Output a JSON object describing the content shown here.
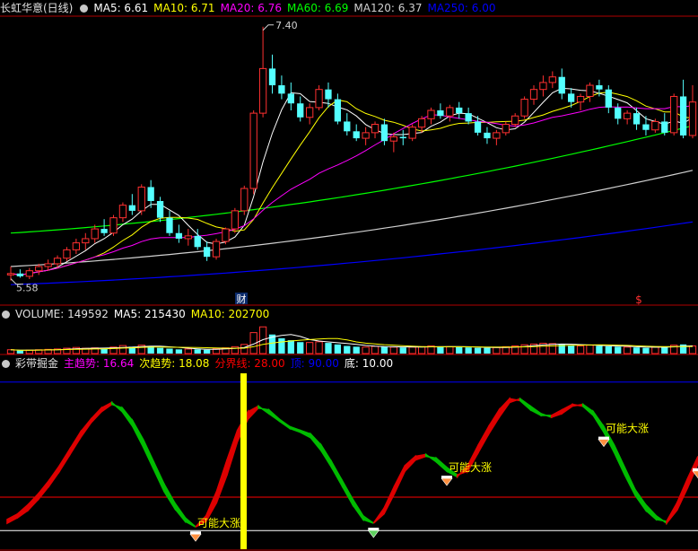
{
  "header_main": {
    "title": "长虹华意(日线)",
    "items": [
      {
        "label": "MA5: 6.61",
        "color": "#ffffff"
      },
      {
        "label": "MA10: 6.71",
        "color": "#ffff00"
      },
      {
        "label": "MA20: 6.76",
        "color": "#ff00ff"
      },
      {
        "label": "MA60: 6.69",
        "color": "#00ff00"
      },
      {
        "label": "MA120: 6.37",
        "color": "#d0d0d0"
      },
      {
        "label": "MA250: 6.00",
        "color": "#0000ff"
      }
    ]
  },
  "header_volume": {
    "title": "VOLUME: 149592",
    "items": [
      {
        "label": "MA5: 215430",
        "color": "#ffffff"
      },
      {
        "label": "MA10: 202700",
        "color": "#ffff00"
      }
    ]
  },
  "header_indicator": {
    "title": "彩带掘金",
    "items": [
      {
        "label": "主趋势: 16.64",
        "color": "#ff00ff"
      },
      {
        "label": "次趋势: 18.08",
        "color": "#ffff00"
      },
      {
        "label": "分界线: 28.00",
        "color": "#ff0000"
      },
      {
        "label": "顶: 90.00",
        "color": "#0000ff"
      },
      {
        "label": "底: 10.00",
        "color": "#ffffff"
      }
    ]
  },
  "annotations": {
    "high_label": "7.40",
    "low_label": "5.58",
    "event_cai": "财",
    "event_s": "$",
    "signal_text": "可能大涨"
  },
  "colors": {
    "up": "#ff3030",
    "down": "#54ffff",
    "ribbon_up": "#dd0000",
    "ribbon_down": "#00bb00",
    "cursor": "#ffff00",
    "panel_border": "#b00000"
  },
  "chart_data": [
    {
      "type": "candlestick",
      "panel": "price",
      "x_unit": "trading day index",
      "ylim": [
        5.5,
        7.45
      ],
      "candles": [
        [
          5.62,
          5.68,
          5.58,
          5.63
        ],
        [
          5.63,
          5.66,
          5.6,
          5.61
        ],
        [
          5.61,
          5.67,
          5.59,
          5.65
        ],
        [
          5.65,
          5.7,
          5.62,
          5.68
        ],
        [
          5.68,
          5.73,
          5.65,
          5.7
        ],
        [
          5.7,
          5.76,
          5.67,
          5.74
        ],
        [
          5.74,
          5.82,
          5.72,
          5.8
        ],
        [
          5.8,
          5.88,
          5.77,
          5.85
        ],
        [
          5.85,
          5.92,
          5.8,
          5.88
        ],
        [
          5.88,
          5.98,
          5.85,
          5.95
        ],
        [
          5.95,
          6.02,
          5.9,
          5.92
        ],
        [
          5.92,
          6.05,
          5.9,
          6.03
        ],
        [
          6.03,
          6.14,
          6.0,
          6.12
        ],
        [
          6.12,
          6.2,
          6.05,
          6.08
        ],
        [
          6.08,
          6.27,
          6.05,
          6.25
        ],
        [
          6.25,
          6.3,
          6.1,
          6.15
        ],
        [
          6.15,
          6.18,
          6.0,
          6.03
        ],
        [
          6.03,
          6.08,
          5.9,
          5.92
        ],
        [
          5.92,
          5.98,
          5.85,
          5.88
        ],
        [
          5.88,
          5.95,
          5.83,
          5.9
        ],
        [
          5.9,
          5.95,
          5.8,
          5.82
        ],
        [
          5.82,
          5.86,
          5.72,
          5.75
        ],
        [
          5.75,
          5.88,
          5.73,
          5.86
        ],
        [
          5.86,
          5.96,
          5.84,
          5.95
        ],
        [
          5.95,
          6.1,
          5.92,
          6.08
        ],
        [
          6.08,
          6.26,
          6.05,
          6.24
        ],
        [
          6.24,
          6.8,
          6.2,
          6.78
        ],
        [
          6.78,
          7.4,
          6.75,
          7.1
        ],
        [
          7.1,
          7.2,
          6.92,
          6.98
        ],
        [
          6.98,
          7.05,
          6.88,
          6.92
        ],
        [
          6.92,
          7.0,
          6.8,
          6.85
        ],
        [
          6.85,
          6.9,
          6.72,
          6.75
        ],
        [
          6.75,
          6.85,
          6.7,
          6.82
        ],
        [
          6.82,
          6.98,
          6.8,
          6.95
        ],
        [
          6.95,
          7.0,
          6.82,
          6.88
        ],
        [
          6.88,
          6.92,
          6.7,
          6.72
        ],
        [
          6.72,
          6.78,
          6.62,
          6.65
        ],
        [
          6.65,
          6.7,
          6.58,
          6.6
        ],
        [
          6.6,
          6.68,
          6.55,
          6.64
        ],
        [
          6.64,
          6.72,
          6.6,
          6.7
        ],
        [
          6.7,
          6.74,
          6.55,
          6.58
        ],
        [
          6.58,
          6.64,
          6.5,
          6.61
        ],
        [
          6.61,
          6.66,
          6.55,
          6.6
        ],
        [
          6.6,
          6.7,
          6.58,
          6.68
        ],
        [
          6.68,
          6.76,
          6.64,
          6.74
        ],
        [
          6.74,
          6.82,
          6.7,
          6.8
        ],
        [
          6.8,
          6.85,
          6.74,
          6.76
        ],
        [
          6.76,
          6.84,
          6.72,
          6.82
        ],
        [
          6.82,
          6.86,
          6.74,
          6.78
        ],
        [
          6.78,
          6.82,
          6.7,
          6.72
        ],
        [
          6.72,
          6.76,
          6.62,
          6.64
        ],
        [
          6.64,
          6.68,
          6.56,
          6.6
        ],
        [
          6.6,
          6.66,
          6.55,
          6.64
        ],
        [
          6.64,
          6.72,
          6.62,
          6.7
        ],
        [
          6.7,
          6.78,
          6.68,
          6.76
        ],
        [
          6.76,
          6.9,
          6.74,
          6.88
        ],
        [
          6.88,
          6.98,
          6.84,
          6.95
        ],
        [
          6.95,
          7.05,
          6.9,
          7.0
        ],
        [
          7.0,
          7.08,
          6.96,
          7.04
        ],
        [
          7.04,
          7.1,
          6.88,
          6.92
        ],
        [
          6.92,
          6.96,
          6.82,
          6.86
        ],
        [
          6.86,
          6.92,
          6.8,
          6.9
        ],
        [
          6.9,
          7.0,
          6.86,
          6.98
        ],
        [
          6.98,
          7.02,
          6.9,
          6.95
        ],
        [
          6.95,
          6.98,
          6.78,
          6.82
        ],
        [
          6.82,
          6.85,
          6.7,
          6.74
        ],
        [
          6.74,
          6.8,
          6.7,
          6.78
        ],
        [
          6.78,
          6.82,
          6.66,
          6.7
        ],
        [
          6.7,
          6.76,
          6.62,
          6.66
        ],
        [
          6.66,
          6.74,
          6.64,
          6.72
        ],
        [
          6.72,
          6.78,
          6.62,
          6.64
        ],
        [
          6.64,
          6.92,
          6.62,
          6.9
        ],
        [
          6.9,
          7.02,
          6.6,
          6.62
        ],
        [
          6.62,
          6.98,
          6.6,
          6.86
        ]
      ],
      "ma_series": [
        {
          "name": "MA5",
          "color": "#ffffff"
        },
        {
          "name": "MA10",
          "color": "#ffff00"
        },
        {
          "name": "MA20",
          "color": "#ff00ff"
        }
      ],
      "long_ma_series": [
        {
          "name": "MA60",
          "color": "#00ff00",
          "from": 5.92,
          "to": 6.69
        },
        {
          "name": "MA120",
          "color": "#d0d0d0",
          "from": 5.68,
          "to": 6.37
        },
        {
          "name": "MA250",
          "color": "#0000ff",
          "from": 5.55,
          "to": 6.0
        }
      ]
    },
    {
      "type": "bar",
      "panel": "volume",
      "values": [
        20,
        16,
        18,
        20,
        22,
        24,
        28,
        32,
        28,
        30,
        26,
        34,
        42,
        36,
        44,
        40,
        30,
        26,
        22,
        24,
        22,
        20,
        26,
        30,
        36,
        48,
        110,
        140,
        100,
        80,
        70,
        60,
        58,
        62,
        56,
        48,
        40,
        36,
        34,
        38,
        36,
        34,
        32,
        34,
        36,
        40,
        38,
        36,
        34,
        32,
        30,
        30,
        32,
        36,
        40,
        46,
        50,
        54,
        52,
        48,
        42,
        40,
        44,
        40,
        38,
        36,
        34,
        32,
        30,
        34,
        36,
        44,
        48,
        40
      ],
      "ylim": [
        0,
        160
      ]
    },
    {
      "type": "ribbon",
      "panel": "indicator",
      "ylim": [
        0,
        100
      ],
      "series": [
        {
          "name": "主趋势",
          "color": "#ff00ff"
        },
        {
          "name": "次趋势",
          "color": "#ffff00"
        }
      ],
      "hlines": [
        {
          "name": "分界线",
          "value": 28,
          "color": "#ff0000"
        },
        {
          "name": "顶",
          "value": 90,
          "color": "#0000ff"
        },
        {
          "name": "底",
          "value": 10,
          "color": "#ffffff"
        }
      ],
      "main": [
        14,
        17,
        21,
        27,
        34,
        42,
        51,
        60,
        68,
        74,
        78,
        76,
        69,
        59,
        47,
        35,
        25,
        17,
        12,
        15,
        25,
        40,
        58,
        70,
        76,
        75,
        70,
        66,
        64,
        62,
        56,
        47,
        37,
        27,
        18,
        14,
        19,
        30,
        42,
        48,
        50,
        49,
        44,
        40,
        42,
        52,
        62,
        71,
        79,
        81,
        77,
        73,
        71,
        73,
        77,
        78,
        74,
        66,
        56,
        44,
        32,
        24,
        18,
        14,
        21,
        33,
        46
      ],
      "sub": [
        16,
        19,
        24,
        30,
        37,
        45,
        54,
        63,
        70,
        76,
        79,
        74,
        66,
        55,
        43,
        31,
        22,
        15,
        12,
        18,
        31,
        48,
        64,
        74,
        77,
        73,
        69,
        65,
        63,
        60,
        53,
        44,
        34,
        24,
        16,
        14,
        22,
        34,
        45,
        50,
        51,
        47,
        42,
        39,
        45,
        56,
        66,
        75,
        81,
        80,
        75,
        72,
        72,
        75,
        78,
        77,
        72,
        63,
        52,
        40,
        29,
        21,
        16,
        15,
        25,
        38,
        50
      ]
    }
  ]
}
